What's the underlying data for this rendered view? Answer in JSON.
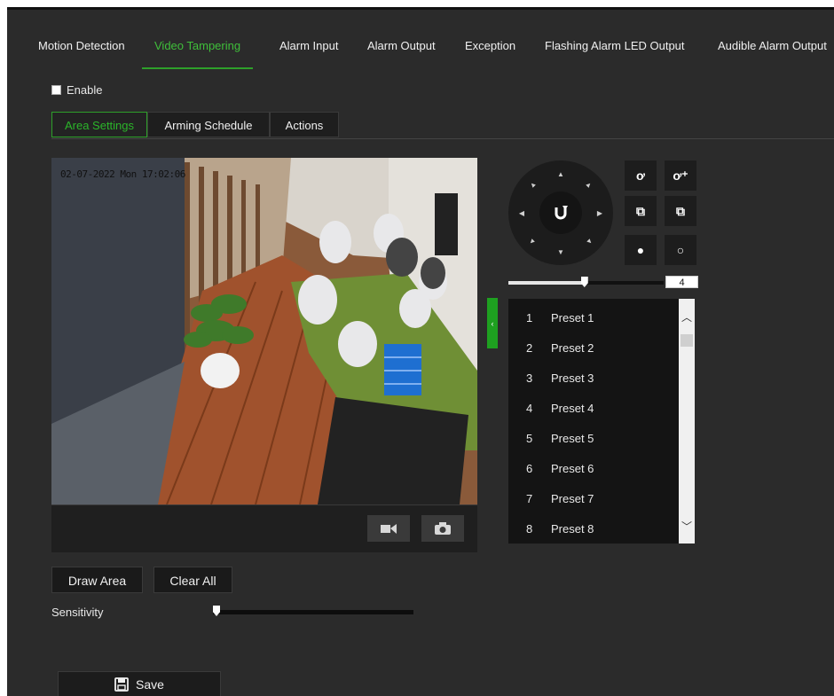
{
  "tabs": [
    "Motion Detection",
    "Video Tampering",
    "Alarm Input",
    "Alarm Output",
    "Exception",
    "Flashing Alarm LED Output",
    "Audible Alarm Output"
  ],
  "active_tab": "Video Tampering",
  "enable": {
    "label": "Enable",
    "checked": false
  },
  "sub_tabs": [
    "Area Settings",
    "Arming Schedule",
    "Actions"
  ],
  "active_sub_tab": "Area Settings",
  "video": {
    "osd_text": "02-07-2022 Mon 17:02:06"
  },
  "ptz": {
    "speed_value": "4",
    "speed_fraction": 0.49
  },
  "presets": [
    {
      "num": "1",
      "name": "Preset 1"
    },
    {
      "num": "2",
      "name": "Preset 2"
    },
    {
      "num": "3",
      "name": "Preset 3"
    },
    {
      "num": "4",
      "name": "Preset 4"
    },
    {
      "num": "5",
      "name": "Preset 5"
    },
    {
      "num": "6",
      "name": "Preset 6"
    },
    {
      "num": "7",
      "name": "Preset 7"
    },
    {
      "num": "8",
      "name": "Preset 8"
    }
  ],
  "buttons": {
    "draw_area": "Draw Area",
    "clear_all": "Clear All",
    "save": "Save"
  },
  "sensitivity": {
    "label": "Sensitivity",
    "value_fraction": 0.0
  },
  "colors": {
    "accent": "#2ea02a",
    "background": "#2b2b2b",
    "panel": "#141414"
  }
}
